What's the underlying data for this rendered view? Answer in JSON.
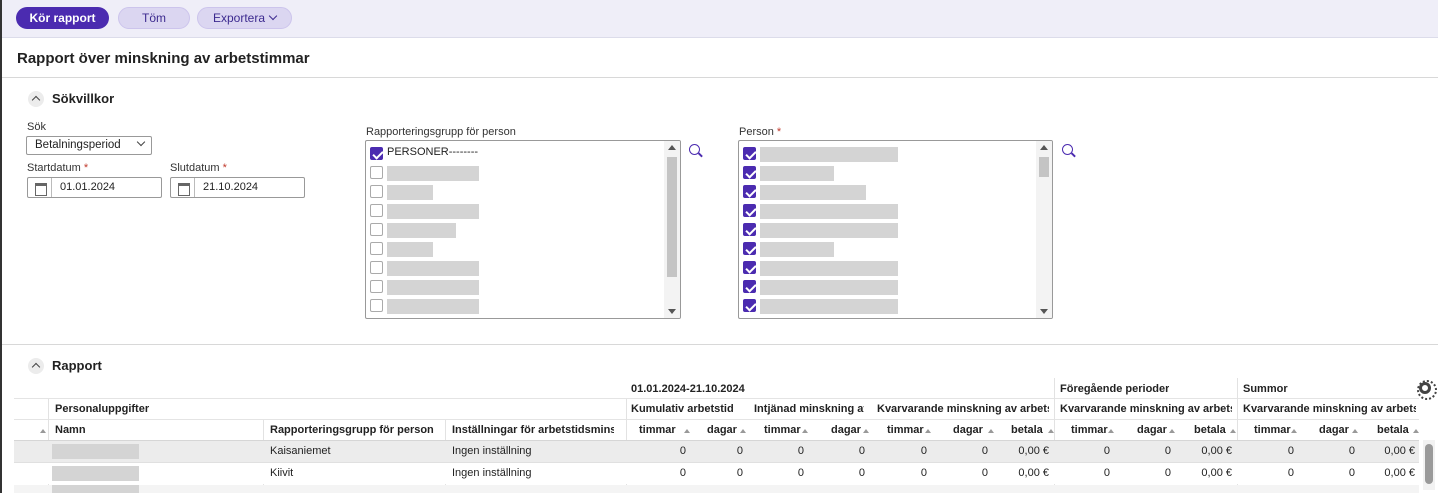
{
  "toolbar": {
    "run_label": "Kör rapport",
    "clear_label": "Töm",
    "export_label": "Exportera"
  },
  "page": {
    "title": "Rapport över minskning av arbetstimmar"
  },
  "search_section": {
    "title": "Sökvillkor",
    "search_label": "Sök",
    "search_value": "Betalningsperiod",
    "start_label": "Startdatum",
    "start_value": "01.01.2024",
    "end_label": "Slutdatum",
    "end_value": "21.10.2024",
    "required_mark": "*",
    "group_label": "Rapporteringsgrupp för person",
    "group_first_item": "PERSONER--------",
    "person_label": "Person"
  },
  "report_section": {
    "title": "Rapport",
    "period_header": "01.01.2024-21.10.2024",
    "previous_header": "Föregående perioder",
    "sums_header": "Summor",
    "personal_header": "Personaluppgifter",
    "group_cumulative": "Kumulativ arbetstid",
    "group_earned": "Intjänad minskning av",
    "group_remaining1": "Kvarvarande minskning av arbetstid",
    "group_remaining2": "Kvarvarande minskning av arbetstid",
    "group_remaining3": "Kvarvarande minskning av arbetstid",
    "col_name": "Namn",
    "col_group": "Rapporteringsgrupp för person",
    "col_settings": "Inställningar för arbetstidsminskning",
    "col_hours": "timmar",
    "col_days": "dagar",
    "col_pay": "betala",
    "rows": [
      {
        "group": "Kaisaniemet",
        "setting": "Ingen inställning",
        "values": [
          "0",
          "0",
          "0",
          "0",
          "0",
          "0",
          "0,00 €",
          "0",
          "0",
          "0,00 €",
          "0",
          "0",
          "0,00 €"
        ]
      },
      {
        "group": "Kiivit",
        "setting": "Ingen inställning",
        "values": [
          "0",
          "0",
          "0",
          "0",
          "0",
          "0",
          "0,00 €",
          "0",
          "0",
          "0,00 €",
          "0",
          "0",
          "0,00 €"
        ]
      }
    ]
  }
}
